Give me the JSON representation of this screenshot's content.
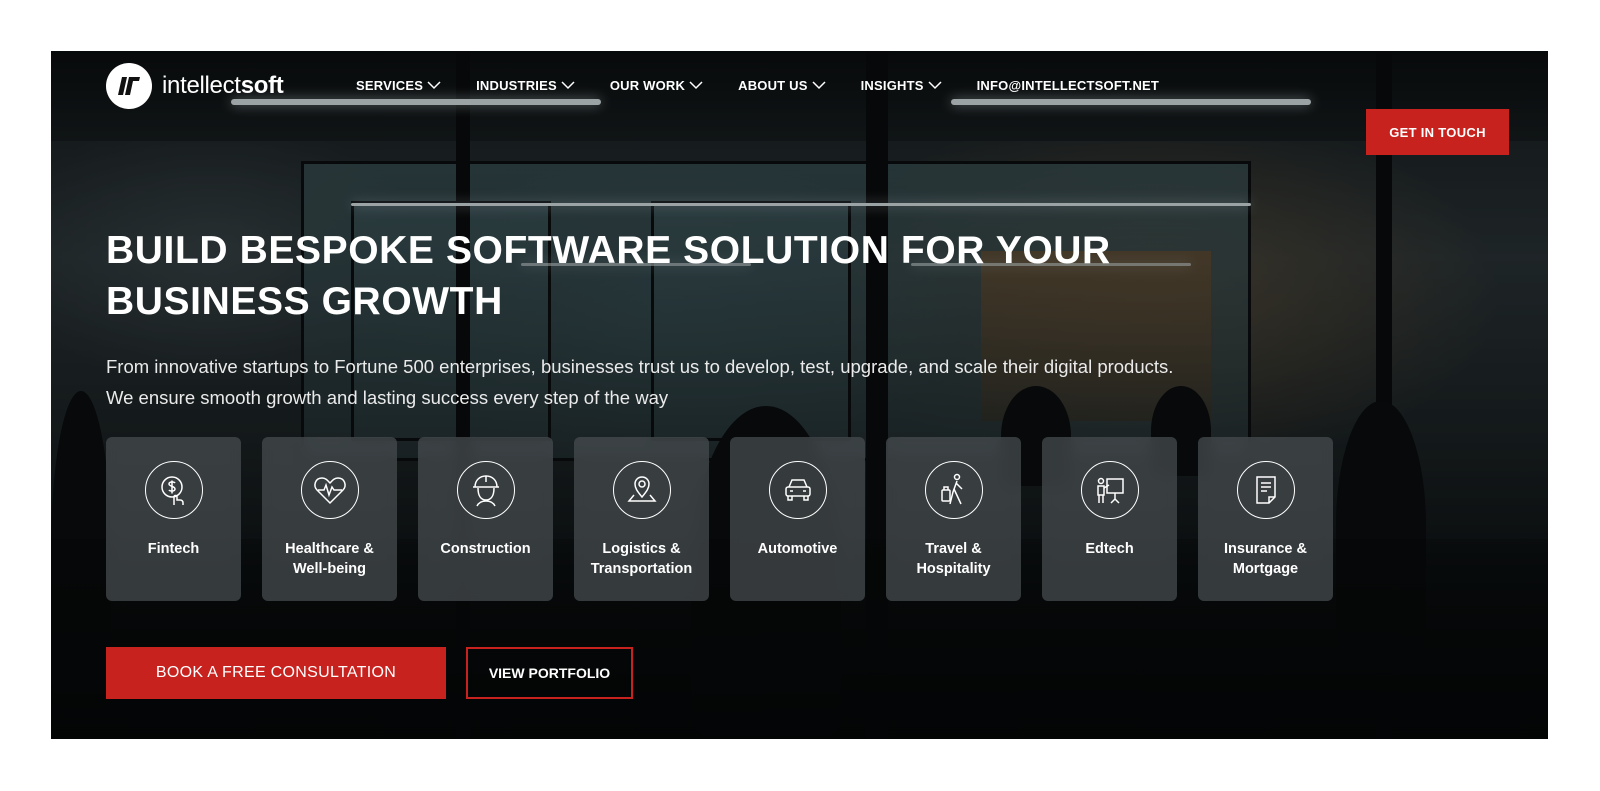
{
  "brand": {
    "logo_icon": "intellectsoft-logo-icon",
    "name_light": "intellect",
    "name_bold": "soft"
  },
  "nav": {
    "items": [
      {
        "label": "SERVICES",
        "icon": "chevron-down-icon"
      },
      {
        "label": "INDUSTRIES",
        "icon": "chevron-down-icon"
      },
      {
        "label": "OUR WORK",
        "icon": "chevron-down-icon"
      },
      {
        "label": "ABOUT US",
        "icon": "chevron-down-icon"
      },
      {
        "label": "INSIGHTS",
        "icon": "chevron-down-icon"
      }
    ],
    "email": "INFO@INTELLECTSOFT.NET"
  },
  "header_cta": {
    "label": "GET IN TOUCH"
  },
  "hero": {
    "title_line1": "BUILD BESPOKE SOFTWARE SOLUTION FOR YOUR",
    "title_line2": "BUSINESS GROWTH",
    "subtitle_line1": "From innovative startups to Fortune 500 enterprises, businesses trust us to develop, test, upgrade, and scale their digital products.",
    "subtitle_line2": "We ensure smooth growth and lasting success every step of the way"
  },
  "industries": [
    {
      "label": "Fintech",
      "icon": "fintech-icon"
    },
    {
      "label": "Healthcare &\nWell-being",
      "icon": "healthcare-icon"
    },
    {
      "label": "Construction",
      "icon": "construction-icon"
    },
    {
      "label": "Logistics &\nTransportation",
      "icon": "logistics-icon"
    },
    {
      "label": "Automotive",
      "icon": "automotive-icon"
    },
    {
      "label": "Travel &\nHospitality",
      "icon": "travel-icon"
    },
    {
      "label": "Edtech",
      "icon": "edtech-icon"
    },
    {
      "label": "Insurance &\nMortgage",
      "icon": "insurance-icon"
    }
  ],
  "actions": {
    "primary": "BOOK A FREE CONSULTATION",
    "secondary": "VIEW PORTFOLIO"
  },
  "colors": {
    "accent": "#c8221f",
    "text": "#ffffff",
    "card_bg": "rgba(72,78,80,0.72)"
  }
}
